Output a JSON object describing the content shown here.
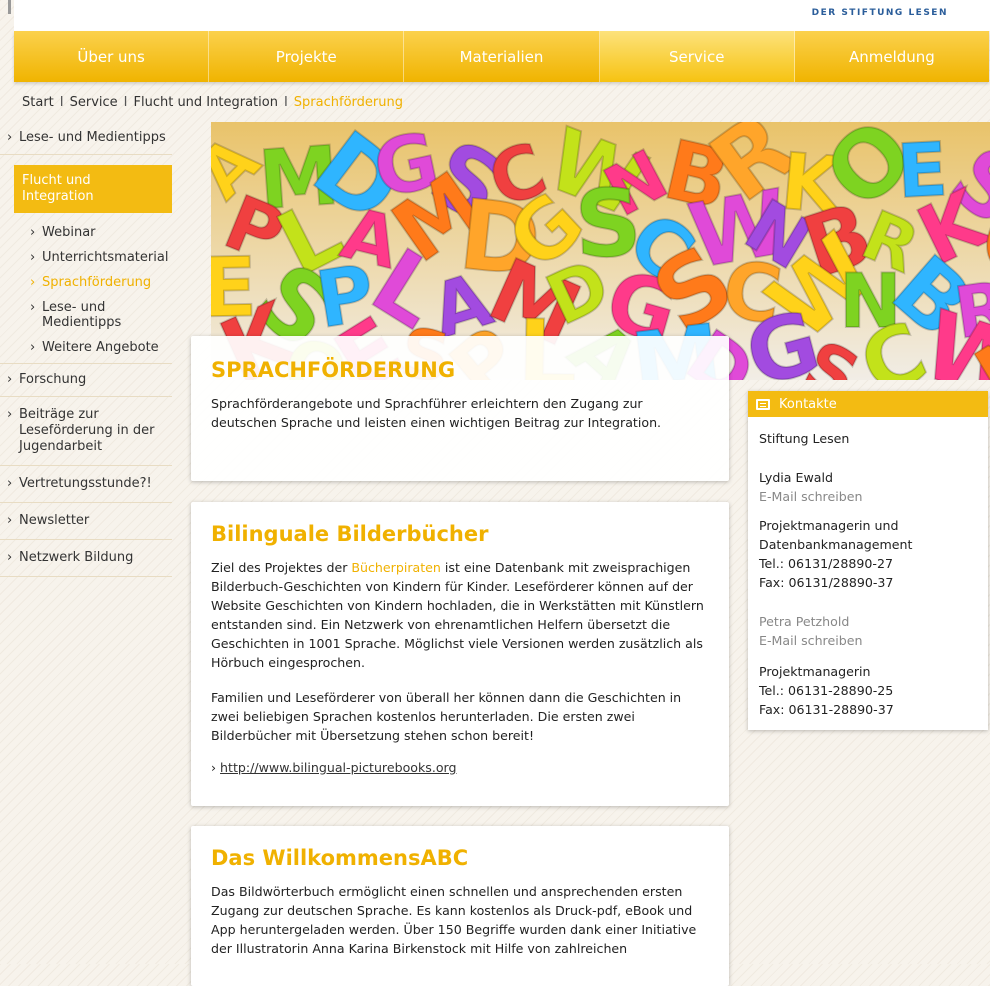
{
  "brand": "DER STIFTUNG LESEN",
  "nav": [
    "Über uns",
    "Projekte",
    "Materialien",
    "Service",
    "Anmeldung"
  ],
  "breadcrumb": {
    "items": [
      "Start",
      "Service",
      "Flucht und Integration"
    ],
    "current": "Sprachförderung",
    "separator": "I"
  },
  "sidebar": {
    "top": "Lese- und Medientipps",
    "active": "Flucht und Integration",
    "sub": [
      "Webinar",
      "Unterrichtsmaterial",
      "Sprachförderung",
      "Lese- und Medientipps",
      "Weitere Angebote"
    ],
    "bottom": [
      "Forschung",
      "Beiträge zur Leseförderung in der Jugendarbeit",
      "Vertretungsstunde?!",
      "Newsletter",
      "Netzwerk Bildung"
    ]
  },
  "intro": {
    "title": "SPRACHFÖRDERUNG",
    "text": "Sprachförderangebote und Sprachführer erleichtern den Zugang zur deutschen Sprache und leisten einen wichtigen Beitrag zur Integration."
  },
  "bilingual": {
    "title": "Bilinguale Bilderbücher",
    "p1_before": "Ziel des Projektes der ",
    "p1_link": "Bücherpiraten",
    "p1_after": " ist eine Datenbank mit zweisprachigen Bilderbuch-Geschichten von Kindern für Kinder. Leseförderer können auf der Website Geschichten von Kindern hochladen, die in Werkstätten mit Künstlern entstanden sind. Ein Netzwerk von ehrenamtlichen Helfern übersetzt die Geschichten in 1001 Sprache. Möglichst viele Versionen werden zusätzlich als Hörbuch eingesprochen.",
    "p2": "Familien und Leseförderer von überall her können dann die Geschichten in zwei beliebigen Sprachen kostenlos herunterladen. Die ersten zwei Bilderbücher mit Übersetzung stehen schon bereit!",
    "url": "http://www.bilingual-picturebooks.org"
  },
  "willkommen": {
    "title": "Das WillkommensABC",
    "text": "Das Bildwörterbuch ermöglicht einen schnellen und ansprechenden ersten Zugang zur deutschen Sprache. Es kann kostenlos als Druck-pdf, eBook und App heruntergeladen werden. Über 150 Begriffe wurden dank einer Initiative der Illustratorin Anna Karina Birkenstock mit Hilfe von zahlreichen"
  },
  "contact": {
    "title": "Kontakte",
    "org": "Stiftung Lesen",
    "p1_name": "Lydia Ewald",
    "email_label": "E-Mail schreiben",
    "p1_role1": "Projektmanagerin und",
    "p1_role2": "Datenbankmanagement",
    "p1_tel": "Tel.: 06131/28890-27",
    "p1_fax": "Fax: 06131/28890-37",
    "p2_name": "Petra Petzhold",
    "p2_role": "Projektmanagerin",
    "p2_tel": "Tel.: 06131-28890-25",
    "p2_fax": "Fax: 06131-28890-37"
  },
  "colors": {
    "accent": "#f0b100",
    "brand_blue": "#2a5d9a"
  },
  "hero_letters": [
    "A",
    "M",
    "D",
    "G",
    "S",
    "C",
    "W",
    "N",
    "B",
    "R",
    "K",
    "O",
    "E",
    "S",
    "P",
    "L"
  ]
}
